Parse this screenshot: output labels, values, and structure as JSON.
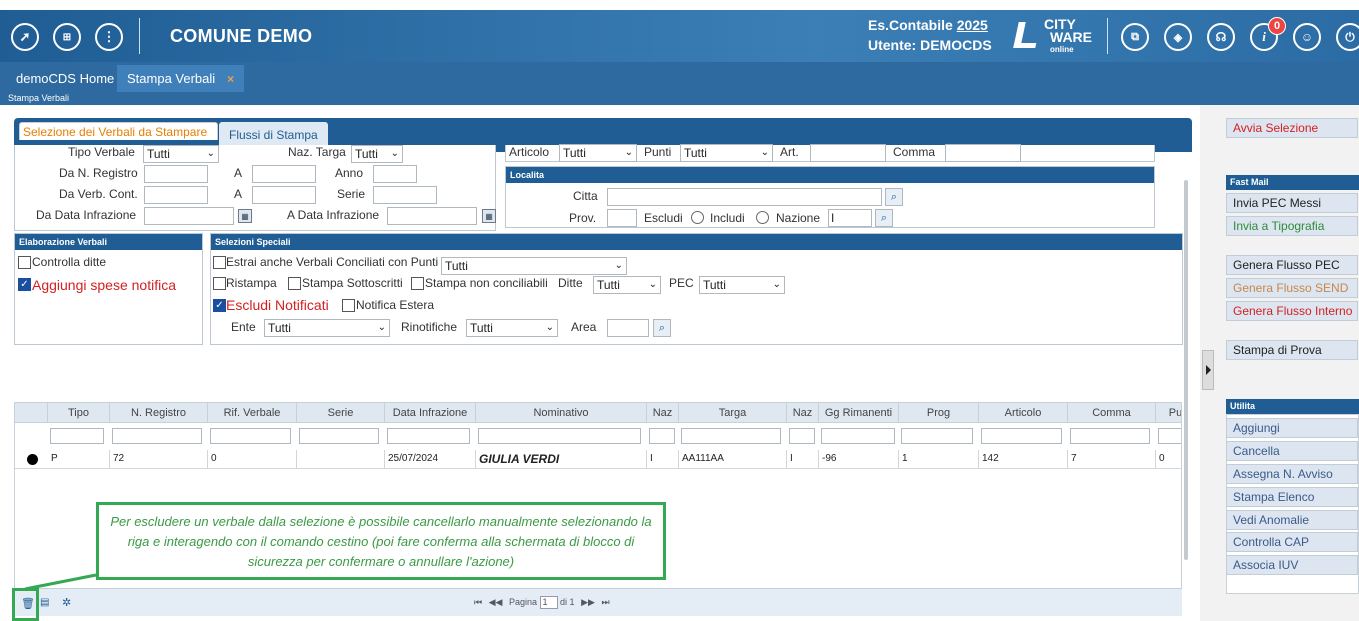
{
  "header": {
    "app_title": "COMUNE DEMO",
    "es_label": "Es.Contabile",
    "es_year": "2025",
    "user_label": "Utente: DEMOCDS",
    "logo_line1": "CITY",
    "logo_line2": "WARE",
    "logo_line3": "online",
    "notif_count": "0",
    "left_icons": [
      "rocket-icon",
      "grid-menu-icon",
      "info-dots-icon"
    ],
    "right_icons": [
      "window-icon",
      "layers-icon",
      "headset-icon",
      "info-icon",
      "user-icon",
      "power-icon"
    ]
  },
  "tabs": [
    {
      "label": "demoCDS Home"
    },
    {
      "label": "Stampa Verbali",
      "close": "×"
    }
  ],
  "breadcrumb": "Stampa Verbali",
  "form_tabs": [
    "Selezione dei Verbali da Stampare",
    "Flussi di Stampa"
  ],
  "filters": {
    "tipo_verbale_label": "Tipo Verbale",
    "tipo_verbale_value": "Tutti",
    "naz_targa_label": "Naz. Targa",
    "naz_targa_value": "Tutti",
    "da_n_registro": "Da N. Registro",
    "a1": "A",
    "anno": "Anno",
    "da_verb_cont": "Da Verb. Cont.",
    "a2": "A",
    "serie": "Serie",
    "da_data": "Da Data Infrazione",
    "a_data": "A Data Infrazione",
    "articolo_label": "Articolo",
    "articolo_value": "Tutti",
    "punti_label": "Punti",
    "punti_value": "Tutti",
    "art_label": "Art.",
    "comma_label": "Comma"
  },
  "localita": {
    "header": "Localita",
    "citta": "Citta",
    "prov": "Prov.",
    "escludi": "Escludi",
    "includi": "Includi",
    "nazione": "Nazione",
    "nazione_value": "I"
  },
  "elaborazione": {
    "header": "Elaborazione Verbali",
    "controlla_ditte": "Controlla ditte",
    "aggiungi_spese": "Aggiungi spese notifica"
  },
  "selezioni": {
    "header": "Selezioni Speciali",
    "estrai": "Estrai anche Verbali Conciliati con Punti",
    "estrai_value": "Tutti",
    "ristampa": "Ristampa",
    "stampa_sottoscritti": "Stampa Sottoscritti",
    "stampa_non_conc": "Stampa non conciliabili",
    "ditte_label": "Ditte",
    "ditte_value": "Tutti",
    "pec_label": "PEC",
    "pec_value": "Tutti",
    "escludi_notificati": "Escludi Notificati",
    "notifica_estera": "Notifica Estera",
    "ente_label": "Ente",
    "ente_value": "Tutti",
    "rinotifiche_label": "Rinotifiche",
    "rinotifiche_value": "Tutti",
    "area_label": "Area"
  },
  "grid": {
    "columns": [
      "Tipo",
      "N. Registro",
      "Rif. Verbale",
      "Serie",
      "Data Infrazione",
      "Nominativo",
      "Naz",
      "Targa",
      "Naz",
      "Gg Rimanenti",
      "Prog",
      "Articolo",
      "Comma",
      "Pu"
    ],
    "row": {
      "tipo": "P",
      "n_registro": "72",
      "rif_verbale": "0",
      "serie": "",
      "data": "25/07/2024",
      "nominativo": "GIULIA VERDI",
      "naz": "I",
      "targa": "AA111AA",
      "naz2": "I",
      "gg": "-96",
      "prog": "1",
      "articolo": "142",
      "comma": "7",
      "pu": "0"
    }
  },
  "pager": {
    "first": "⏮",
    "prev": "◀◀",
    "pagina": "Pagina",
    "page": "1",
    "of": "di 1",
    "next": "▶▶",
    "last": "⏭"
  },
  "callout": "Per escludere un verbale dalla selezione è possibile cancellarlo manualmente selezionando la riga e interagendo con il comando cestino (poi fare conferma alla schermata di blocco di sicurezza per confermare o annullare l'azione)",
  "sidebar": {
    "avvia": "Avvia Selezione",
    "fast_mail_header": "Fast Mail",
    "invia_pec": "Invia PEC Messi",
    "invia_tipografia": "Invia a Tipografia",
    "genera_pec": "Genera Flusso PEC",
    "genera_send": "Genera Flusso SEND",
    "genera_interno": "Genera Flusso Interno",
    "stampa_prova": "Stampa di Prova",
    "utilita_header": "Utilita",
    "utilita": [
      "Aggiungi",
      "Cancella",
      "Assegna N. Avviso",
      "Stampa Elenco",
      "Vedi Anomalie",
      "Controlla CAP",
      "Associa IUV"
    ]
  },
  "colors": {
    "brand": "#1f5d94",
    "accent_orange": "#e67e00",
    "red": "#d42020",
    "green": "#34a853"
  }
}
